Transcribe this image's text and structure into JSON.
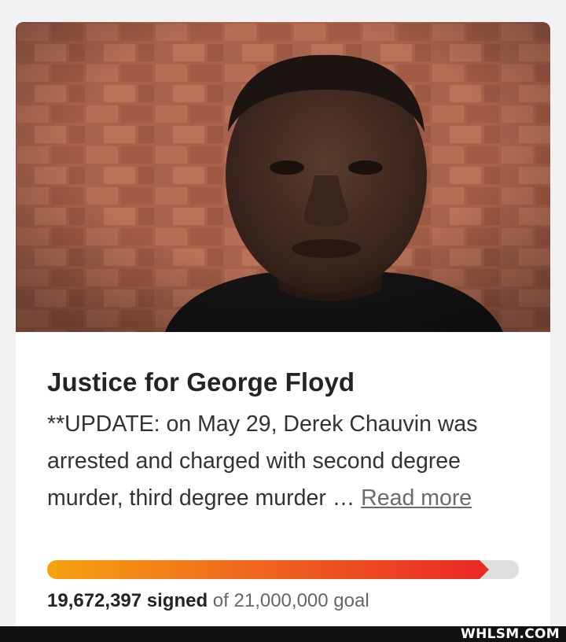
{
  "petition": {
    "image_alt": "Photo of George Floyd in front of a brick wall",
    "title": "Justice for George Floyd",
    "description": "**UPDATE: on May 29, Derek Chauvin was arrested and charged with second degree murder, third degree murder … ",
    "read_more_label": "Read more",
    "signed_count": "19,672,397 signed",
    "goal_text": " of 21,000,000 goal",
    "progress_fraction": 0.9368
  },
  "footer": {
    "watermark": "WHLSM.COM"
  },
  "colors": {
    "progress_start": "#f7a20f",
    "progress_end": "#ea2a24",
    "progress_track": "#dedede"
  }
}
